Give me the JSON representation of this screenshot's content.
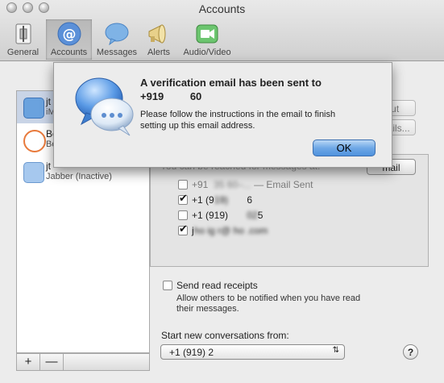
{
  "window": {
    "title": "Accounts"
  },
  "toolbar": {
    "items": [
      {
        "label": "General",
        "icon": "general-icon"
      },
      {
        "label": "Accounts",
        "icon": "at-sign-icon"
      },
      {
        "label": "Messages",
        "icon": "speech-bubble-icon"
      },
      {
        "label": "Alerts",
        "icon": "megaphone-icon"
      },
      {
        "label": "Audio/Video",
        "icon": "video-camera-icon"
      }
    ]
  },
  "accounts": [
    {
      "name": "jt",
      "status": "iM"
    },
    {
      "name": "Bo",
      "status": "Bo"
    },
    {
      "name": "jt",
      "status": "Jabber (Inactive)"
    }
  ],
  "sheet": {
    "title_line1": "A verification email has been sent to",
    "title_line2": "+919",
    "title_line2_end": "60",
    "body_line1": "Please follow the instructions in the email to finish",
    "body_line2": "setting up this email address.",
    "ok_label": "OK"
  },
  "panel": {
    "sign_out_label": "Out",
    "details_label": "Details...",
    "reached_label": "You can be reached for messages at:",
    "add_email_label": "mail",
    "addresses": [
      {
        "text": "+91",
        "suffix": "— Email Sent",
        "checked": false
      },
      {
        "text": "+1 (9",
        "suffix": "6",
        "checked": true
      },
      {
        "text": "+1 (919)",
        "suffix": "5",
        "checked": false
      },
      {
        "text": "j",
        "suffix": "",
        "checked": true
      }
    ]
  },
  "send_read": {
    "label": "Send read receipts",
    "desc_line1": "Allow others to be notified when you have read",
    "desc_line2": "their messages.",
    "checked": false
  },
  "start_from": {
    "label": "Start new conversations from:",
    "value": "+1 (919) 2"
  },
  "list_buttons": {
    "add": "+",
    "remove": "—"
  },
  "help_label": "?"
}
